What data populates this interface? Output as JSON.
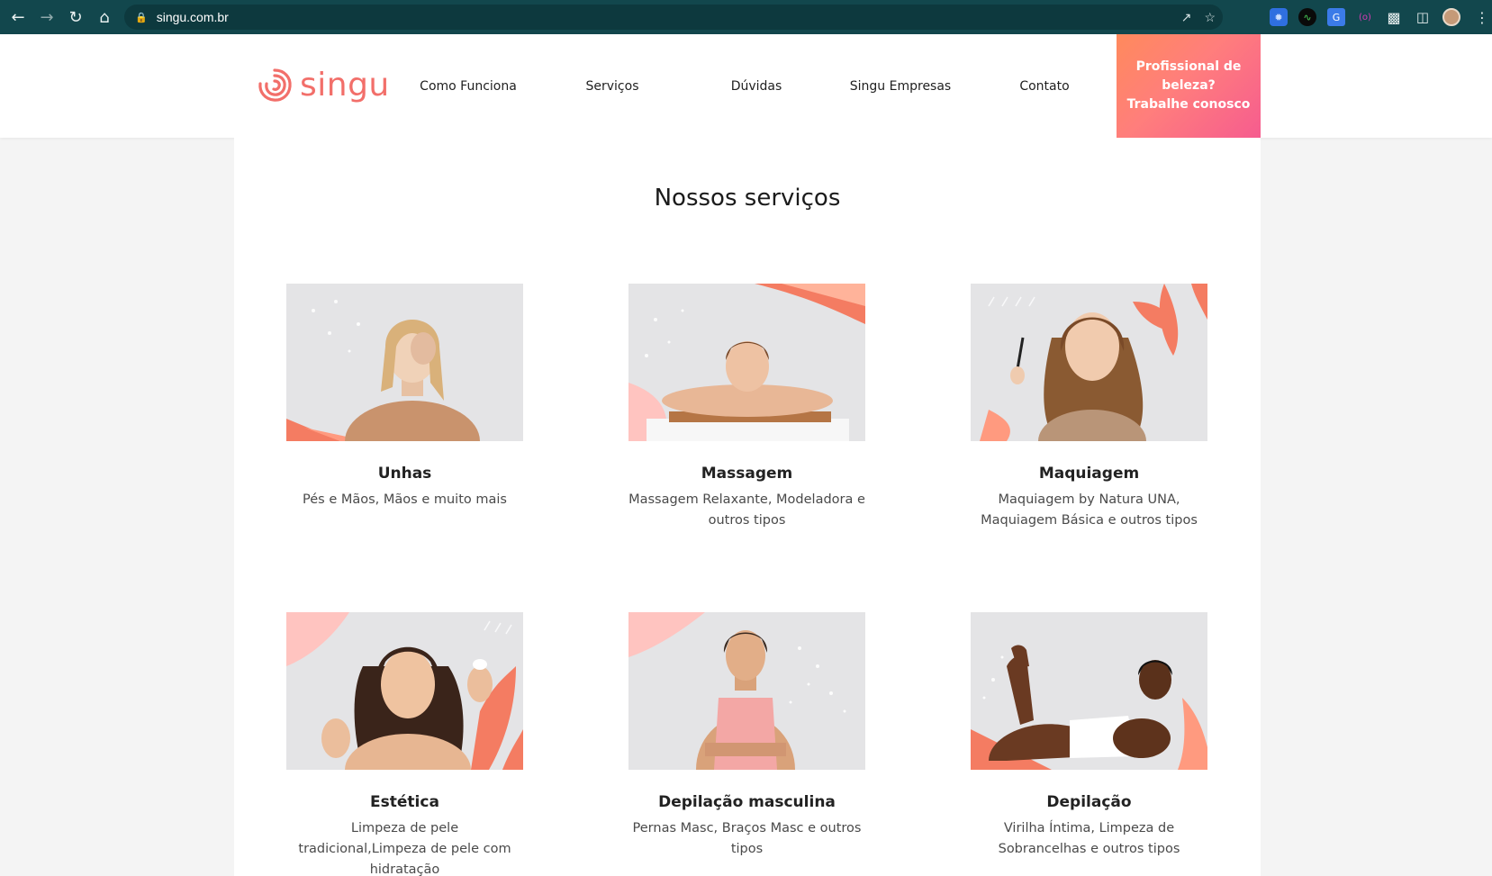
{
  "browser": {
    "url": "singu.com.br"
  },
  "header": {
    "logo_text": "singu",
    "nav": [
      "Como Funciona",
      "Serviços",
      "Dúvidas",
      "Singu Empresas",
      "Contato"
    ],
    "cta_lines": [
      "Profissional de",
      "beleza?",
      "Trabalhe conosco"
    ]
  },
  "main": {
    "title": "Nossos serviços",
    "services": [
      {
        "title": "Unhas",
        "desc": "Pés e Mãos, Mãos e muito mais"
      },
      {
        "title": "Massagem",
        "desc": "Massagem Relaxante, Modeladora e outros tipos"
      },
      {
        "title": "Maquiagem",
        "desc": "Maquiagem by Natura UNA, Maquiagem Básica e outros tipos"
      },
      {
        "title": "Estética",
        "desc": "Limpeza de pele tradicional,Limpeza de pele com hidratação"
      },
      {
        "title": "Depilação masculina",
        "desc": "Pernas Masc, Braços Masc e outros tipos"
      },
      {
        "title": "Depilação",
        "desc": "Virilha Íntima, Limpeza de Sobrancelhas e outros tipos"
      }
    ]
  },
  "colors": {
    "brand": "#f26f6a",
    "chrome": "#12474d"
  }
}
